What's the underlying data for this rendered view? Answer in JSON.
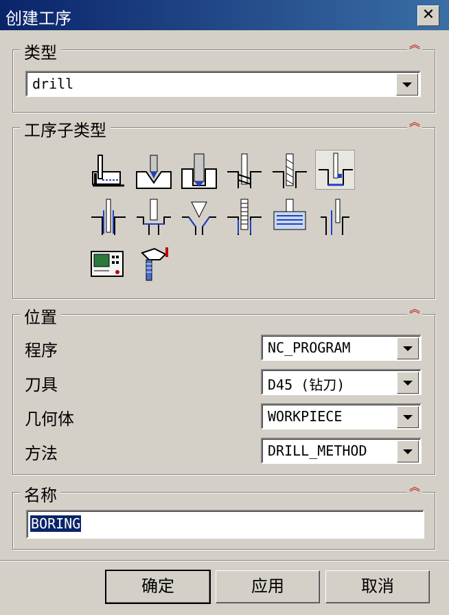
{
  "window": {
    "title": "创建工序",
    "close_label": "✕"
  },
  "type_section": {
    "label": "类型",
    "value": "drill"
  },
  "subtype_section": {
    "label": "工序子类型",
    "icons": [
      "spot-facing-icon",
      "spot-drilling-icon",
      "drilling-icon",
      "peck-drilling-icon",
      "breakchip-drilling-icon",
      "boring-icon",
      "reaming-icon",
      "counterboring-icon",
      "countersinking-icon",
      "tapping-icon",
      "thread-milling-icon",
      "hole-milling-icon",
      "mill-control-icon",
      "mill-user-icon"
    ],
    "selected": "boring-icon"
  },
  "location_section": {
    "label": "位置",
    "fields": [
      {
        "label": "程序",
        "value": "NC_PROGRAM"
      },
      {
        "label": "刀具",
        "value": "D45 (钻刀)"
      },
      {
        "label": "几何体",
        "value": "WORKPIECE"
      },
      {
        "label": "方法",
        "value": "DRILL_METHOD"
      }
    ]
  },
  "name_section": {
    "label": "名称",
    "value": "BORING"
  },
  "buttons": {
    "ok": "确定",
    "apply": "应用",
    "cancel": "取消"
  },
  "colors": {
    "title_bar": "#0a246a",
    "collapse_arrows": "#c00000",
    "dialog_bg": "#d4d0c8"
  }
}
